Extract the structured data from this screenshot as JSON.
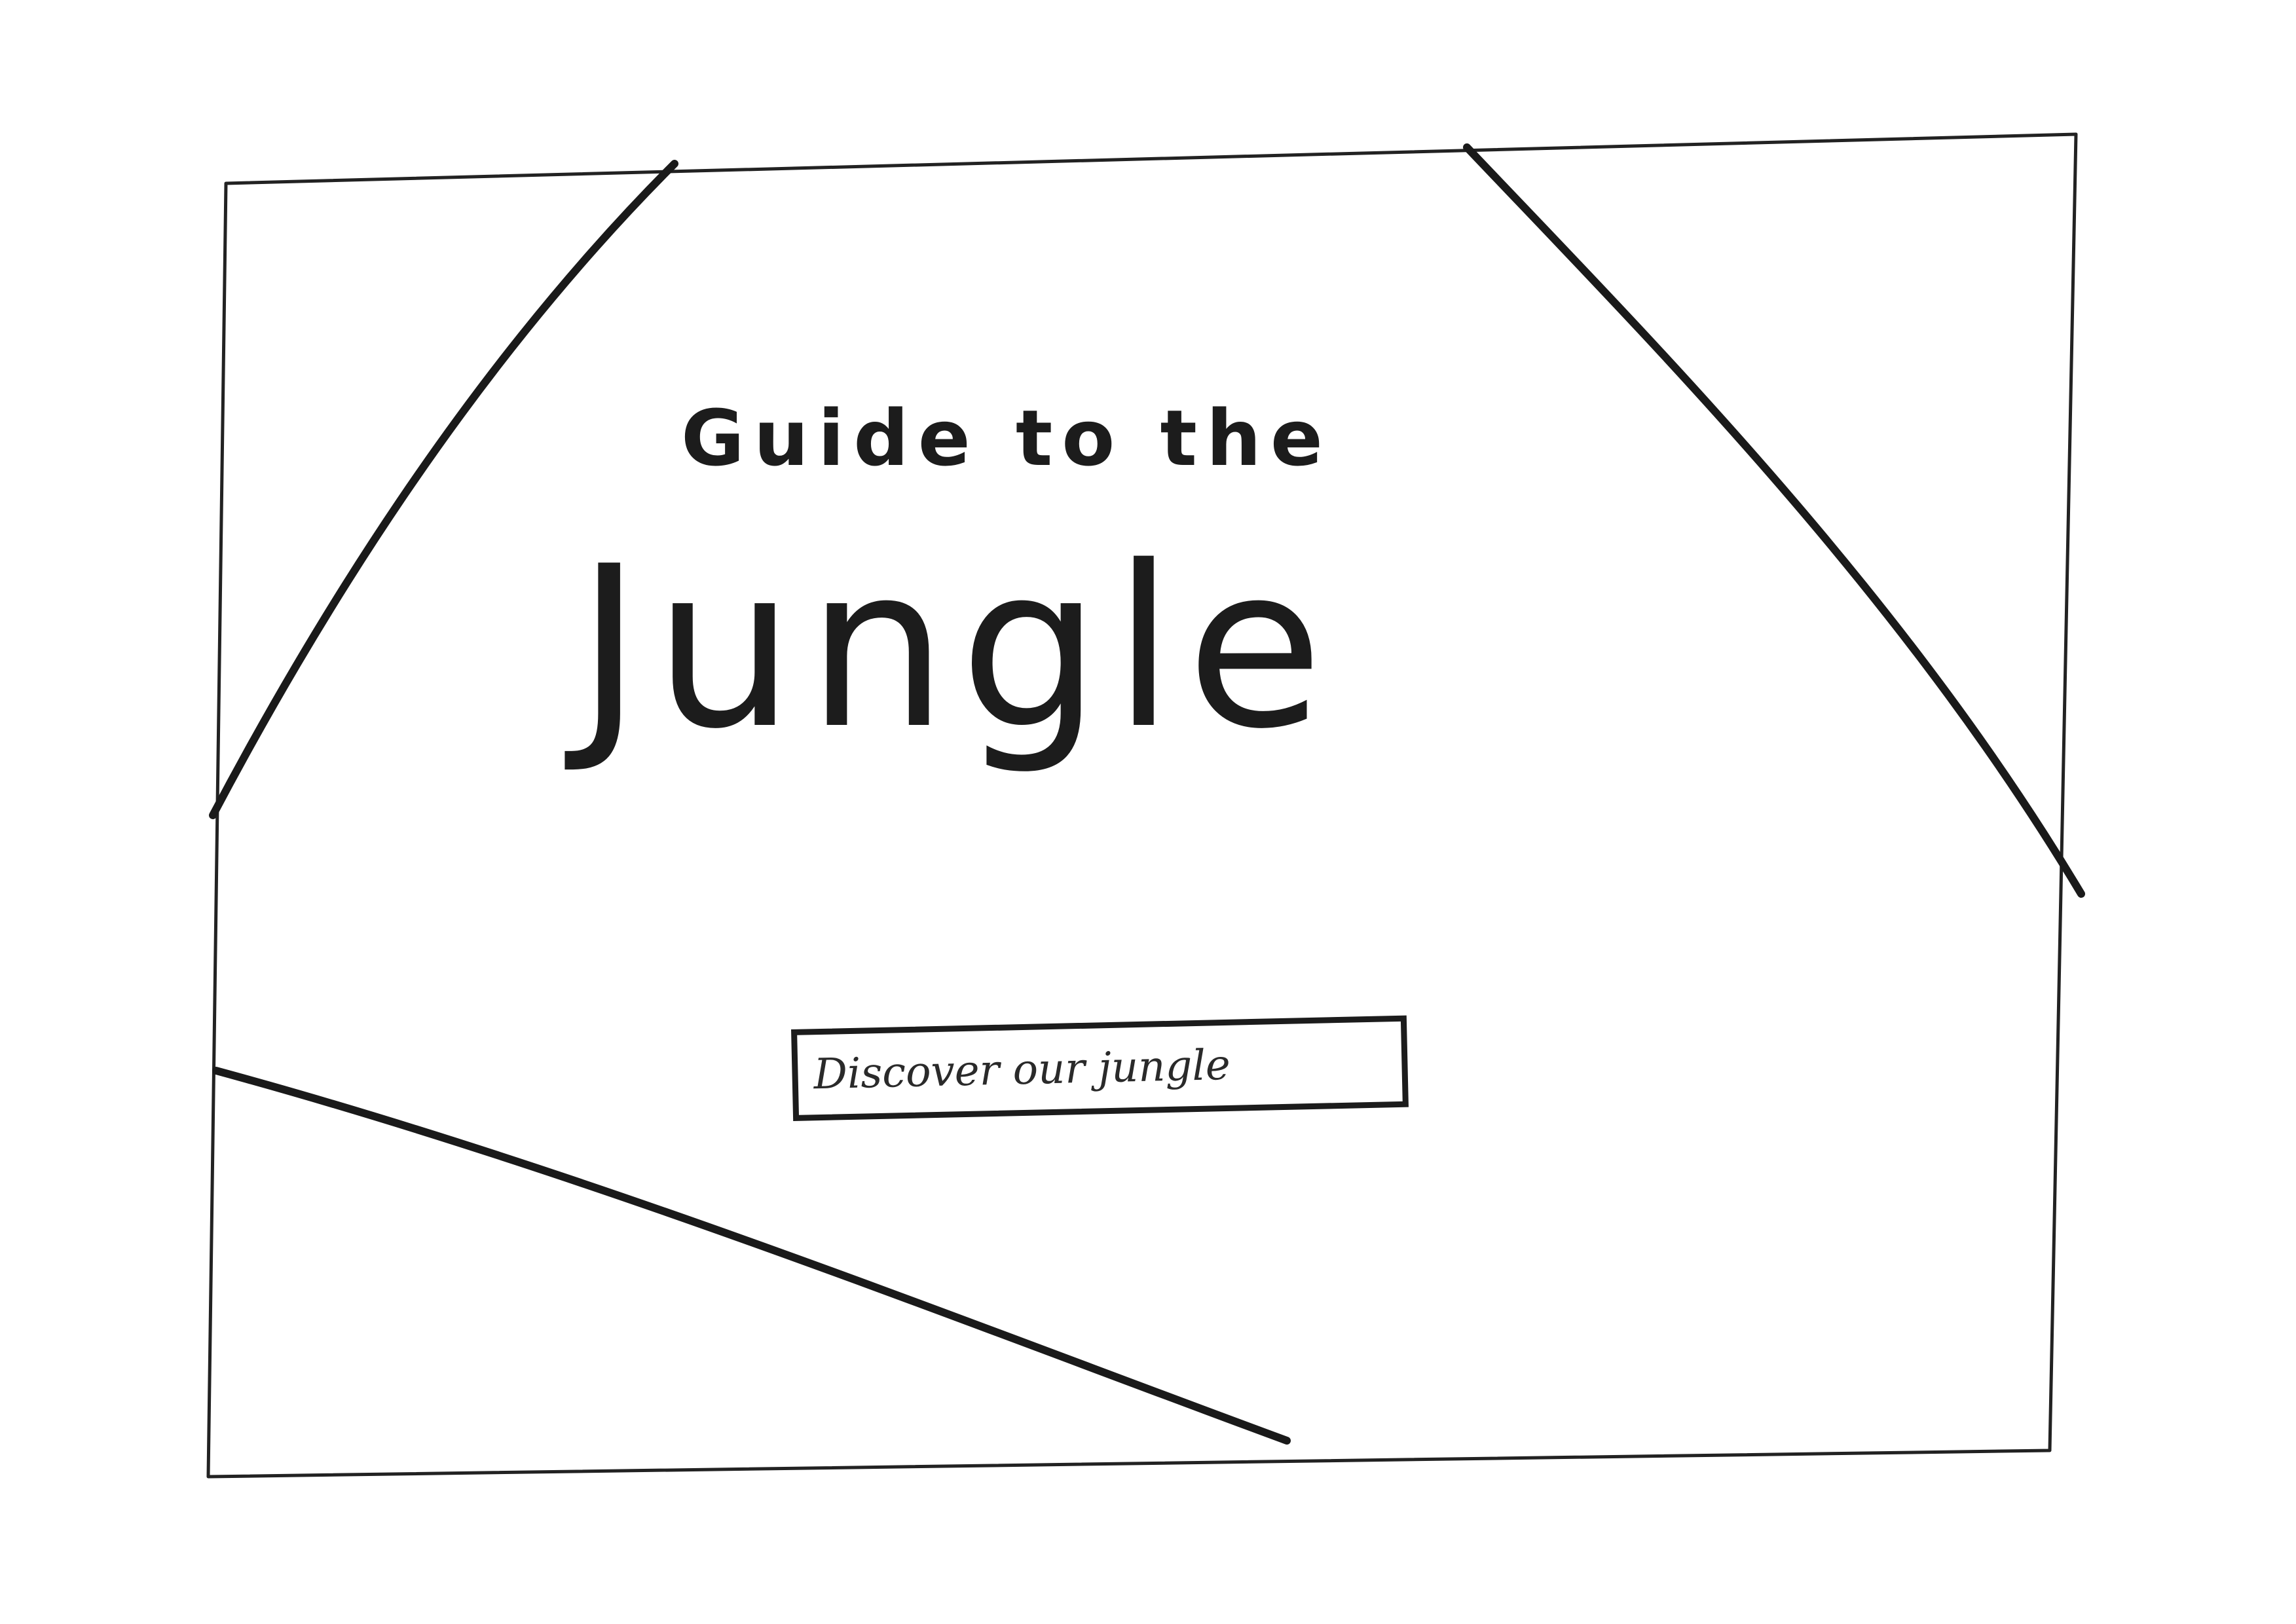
{
  "hero": {
    "subtitle": "Guide to the",
    "title": "Jungle"
  },
  "cta": {
    "label": "Discover our jungle"
  },
  "colors": {
    "ink": "#1c1c1c",
    "paper": "#ffffff"
  }
}
